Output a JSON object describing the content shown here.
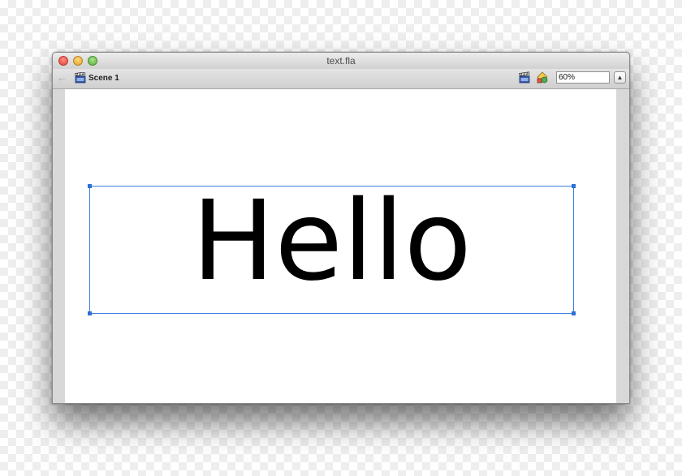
{
  "window": {
    "title": "text.fla"
  },
  "toolbar": {
    "back_icon": "arrow-left-icon",
    "scene_icon": "clapperboard-icon",
    "scene_label": "Scene 1",
    "edit_scene_icon": "clapperboard-icon",
    "edit_symbol_icon": "symbol-icon",
    "zoom_value": "60%"
  },
  "stage": {
    "text": "Hello"
  },
  "colors": {
    "selection": "#3c7fe0",
    "stage": "#ffffff",
    "pasteboard": "#d8d8d8"
  }
}
